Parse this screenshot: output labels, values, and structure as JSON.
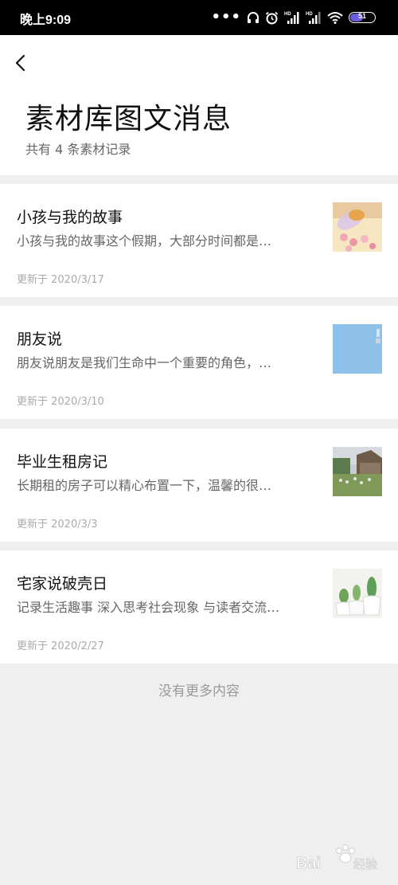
{
  "status_bar": {
    "time": "晚上9:09",
    "battery": "51",
    "icons": [
      "more-dots-icon",
      "headset-icon",
      "alarm-icon",
      "signal-hd-icon",
      "signal-hd-icon",
      "wifi-icon",
      "battery-icon"
    ]
  },
  "header": {
    "back_icon": "back-arrow-icon",
    "title": "素材库图文消息",
    "subtitle": "共有 4 条素材记录"
  },
  "articles": [
    {
      "title": "小孩与我的故事",
      "desc": "小孩与我的故事这个假期，大部分时间都是…",
      "date": "更新于 2020/3/17",
      "thumb": "pills-photo"
    },
    {
      "title": "朋友说",
      "desc": "朋友说朋友是我们生命中一个重要的角色，…",
      "date": "更新于 2020/3/10",
      "thumb": "sky-photo"
    },
    {
      "title": "毕业生租房记",
      "desc": "长期租的房子可以精心布置一下，温馨的很…",
      "date": "更新于 2020/3/3",
      "thumb": "farmhouse-photo"
    },
    {
      "title": "宅家说破壳日",
      "desc": "记录生活趣事 深入思考社会现象 与读者交流…",
      "date": "更新于 2020/2/27",
      "thumb": "succulents-photo"
    }
  ],
  "footer": {
    "no_more": "没有更多内容"
  },
  "watermark": {
    "text": "Bai du 经验"
  }
}
